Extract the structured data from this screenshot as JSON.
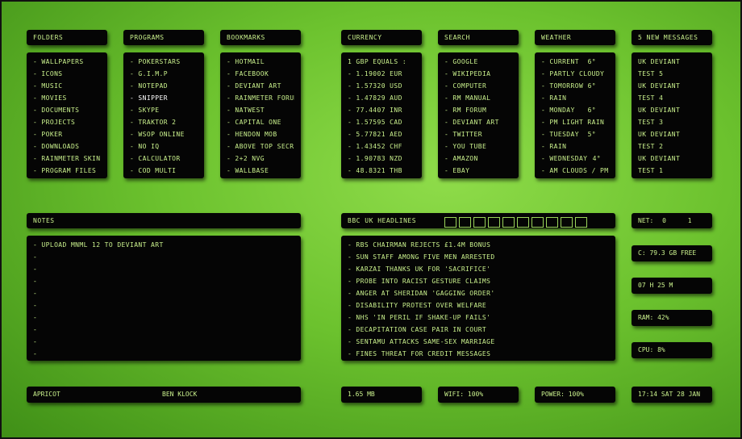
{
  "folders": {
    "title": "FOLDERS",
    "items": [
      "- WALLPAPERS",
      "- ICONS",
      "- MUSIC",
      "- MOVIES",
      "- DOCUMENTS",
      "- PROJECTS",
      "- POKER",
      "- DOWNLOADS",
      "- RAINMETER SKINS",
      "- PROGRAM FILES"
    ]
  },
  "programs": {
    "title": "PROGRAMS",
    "items": [
      "- POKERSTARS",
      "- G.I.M.P",
      "- NOTEPAD",
      "- SNIPPER",
      "- SKYPE",
      "- TRAKTOR 2",
      "- WSOP ONLINE",
      "- NO IQ",
      "- CALCULATOR",
      "- COD MULTI"
    ],
    "highlighted_index": 3
  },
  "bookmarks": {
    "title": "BOOKMARKS",
    "items": [
      "- HOTMAIL",
      "- FACEBOOK",
      "- DEVIANT ART",
      "- RAINMETER FORUM",
      "- NATWEST",
      "- CAPITAL ONE",
      "- HENDON MOB",
      "- ABOVE TOP SECRET",
      "- 2+2 NVG",
      "- WALLBASE"
    ]
  },
  "currency": {
    "title": "CURRENCY",
    "items": [
      "1 GBP EQUALS :",
      "- 1.19002 EUR",
      "- 1.57320 USD",
      "- 1.47829 AUD",
      "- 77.4407 INR",
      "- 1.57595 CAD",
      "- 5.77821 AED",
      "- 1.43452 CHF",
      "- 1.90783 NZD",
      "- 48.8321 THB"
    ]
  },
  "search": {
    "title": "SEARCH",
    "items": [
      "- GOOGLE",
      "- WIKIPEDIA",
      "- COMPUTER",
      "- RM MANUAL",
      "- RM FORUM",
      "- DEVIANT ART",
      "- TWITTER",
      "- YOU TUBE",
      "- AMAZON",
      "- EBAY"
    ]
  },
  "weather": {
    "title": "WEATHER",
    "rows": [
      {
        "label": "- CURRENT",
        "value": "6°"
      },
      {
        "label": "- PARTLY CLOUDY",
        "value": ""
      },
      {
        "label": "- TOMORROW",
        "value": "6°"
      },
      {
        "label": "- RAIN",
        "value": ""
      },
      {
        "label": "- MONDAY",
        "value": "6°"
      },
      {
        "label": "- PM LIGHT RAIN",
        "value": ""
      },
      {
        "label": "- TUESDAY",
        "value": "5°"
      },
      {
        "label": "- RAIN",
        "value": ""
      },
      {
        "label": "- WEDNESDAY",
        "value": "4°"
      },
      {
        "label": "- AM CLOUDS / PM...",
        "value": ""
      }
    ]
  },
  "messages": {
    "title": "5 NEW MESSAGES",
    "items": [
      "UK DEVIANT",
      "TEST 5",
      "UK DEVIANT",
      "TEST 4",
      "UK DEVIANT",
      "TEST 3",
      "UK DEVIANT",
      "TEST 2",
      "UK DEVIANT",
      "TEST 1"
    ]
  },
  "notes": {
    "title": "NOTES",
    "items": [
      "- UPLOAD MNML 12 TO DEVIANT ART",
      "-",
      "-",
      "-",
      "-",
      "-",
      "-",
      "-",
      "-",
      "-"
    ]
  },
  "headlines": {
    "title": "BBC UK HEADLINES",
    "items": [
      "- RBS CHAIRMAN REJECTS £1.4M BONUS",
      "- SUN STAFF AMONG FIVE MEN ARRESTED",
      "- KARZAI THANKS UK FOR 'SACRIFICE'",
      "- PROBE INTO RACIST GESTURE CLAIMS",
      "- ANGER AT SHERIDAN 'GAGGING ORDER'",
      "- DISABILITY PROTEST OVER WELFARE",
      "- NHS 'IN PERIL IF SHAKE-UP FAILS'",
      "- DECAPITATION CASE PAIR IN COURT",
      "- SENTAMU ATTACKS SAME-SEX MARRIAGE",
      "- FINES THREAT FOR CREDIT MESSAGES"
    ]
  },
  "stats": {
    "net_label": "NET:",
    "net_down": "0",
    "net_up": "1",
    "disk": "C:  79.3 GB FREE",
    "uptime": "07 H 25 M",
    "ram": "RAM: 42%",
    "cpu": "CPU: 8%"
  },
  "bottom": {
    "music_artist": "APRICOT",
    "music_track": "BEN KLOCK",
    "size": "1.65 MB",
    "wifi": "WIFI: 100%",
    "power": "POWER: 100%",
    "clock": "17:14   SAT 28 JAN"
  },
  "colors": {
    "text": "#c9f08c",
    "panel": "#050505",
    "accent": "#9ad45a"
  }
}
